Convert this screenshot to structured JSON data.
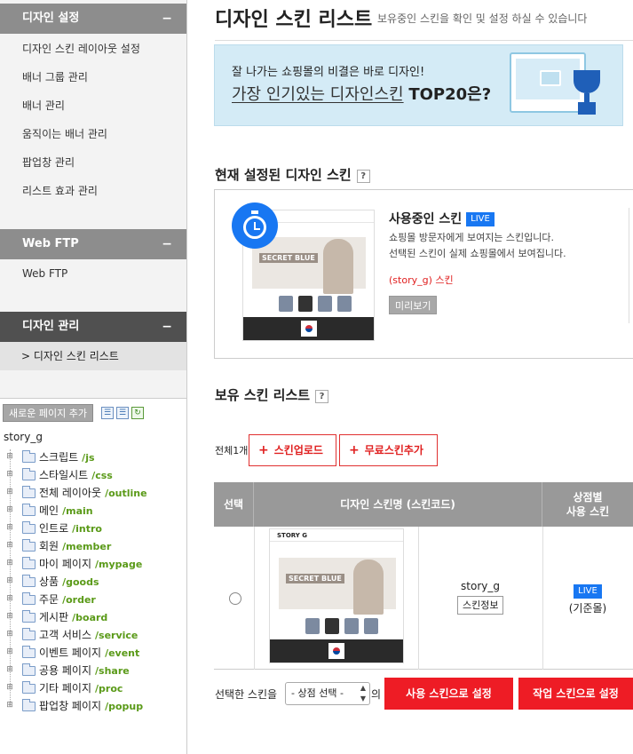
{
  "sidebar": {
    "design_settings": {
      "title": "디자인 설정",
      "toggle": "−",
      "items": [
        "디자인 스킨 레이아웃 설정",
        "배너 그룹 관리",
        "배너 관리",
        "움직이는 배너 관리",
        "팝업창 관리",
        "리스트 효과 관리"
      ]
    },
    "web_ftp": {
      "title": "Web FTP",
      "toggle": "−",
      "items": [
        "Web FTP"
      ]
    },
    "design_manage": {
      "title": "디자인 관리",
      "toggle": "−",
      "sub_item": "> 디자인 스킨 리스트"
    },
    "tree": {
      "add_page_button": "새로운 페이지 추가",
      "root": "story_g",
      "nodes": [
        {
          "name": "스크립트",
          "path": "/js"
        },
        {
          "name": "스타일시트",
          "path": "/css"
        },
        {
          "name": "전체 레이아웃",
          "path": "/outline"
        },
        {
          "name": "메인",
          "path": "/main"
        },
        {
          "name": "인트로",
          "path": "/intro"
        },
        {
          "name": "회원",
          "path": "/member"
        },
        {
          "name": "마이 페이지",
          "path": "/mypage"
        },
        {
          "name": "상품",
          "path": "/goods"
        },
        {
          "name": "주문",
          "path": "/order"
        },
        {
          "name": "게시판",
          "path": "/board"
        },
        {
          "name": "고객 서비스",
          "path": "/service"
        },
        {
          "name": "이벤트 페이지",
          "path": "/event"
        },
        {
          "name": "공용 페이지",
          "path": "/share"
        },
        {
          "name": "기타 페이지",
          "path": "/proc"
        },
        {
          "name": "팝업창 페이지",
          "path": "/popup"
        }
      ]
    }
  },
  "main": {
    "title": "디자인 스킨 리스트",
    "subtitle": "보유중인 스킨을 확인 및 설정 하실 수 있습니다",
    "banner": {
      "line1": "잘 나가는 쇼핑몰의 비결은 바로 디자인!",
      "line2_underlined": "가장 인기있는 디자인스킨",
      "line2_bold": "TOP20은?"
    },
    "current_skin": {
      "section_title": "현재 설정된 디자인 스킨",
      "help": "?",
      "using_title": "사용중인 스킨",
      "live": "LIVE",
      "desc1": "쇼핑몰 방문자에게 보여지는 스킨입니다.",
      "desc2": "선택된 스킨이 실제 쇼핑몰에서 보여집니다.",
      "skin_code": "(story_g) 스킨",
      "preview_button": "미리보기",
      "thumb_text": "SECRET BLUE"
    },
    "owned": {
      "section_title": "보유 스킨 리스트",
      "help": "?",
      "total": "전체1개",
      "upload_button": "스킨업로드",
      "free_add_button": "무료스킨추가",
      "columns": [
        "선택",
        "디자인 스킨명 (스킨코드)",
        "상점별\n사용 스킨"
      ],
      "rows": [
        {
          "logo": "STORY G",
          "thumb_text": "SECRET BLUE",
          "name": "story_g",
          "info_button": "스킨정보",
          "live": "LIVE",
          "store": "(기준몰)"
        }
      ]
    },
    "bottom": {
      "label": "선택한 스킨을",
      "select_value": "- 상점 선택 -",
      "suffix": "의",
      "set_live_button": "사용 스킨으로 설정",
      "set_work_button": "작업 스킨으로 설정"
    }
  },
  "colors": {
    "accent_red": "#ee1c25",
    "live_blue": "#1877f2",
    "path_green": "#5a9a18"
  }
}
